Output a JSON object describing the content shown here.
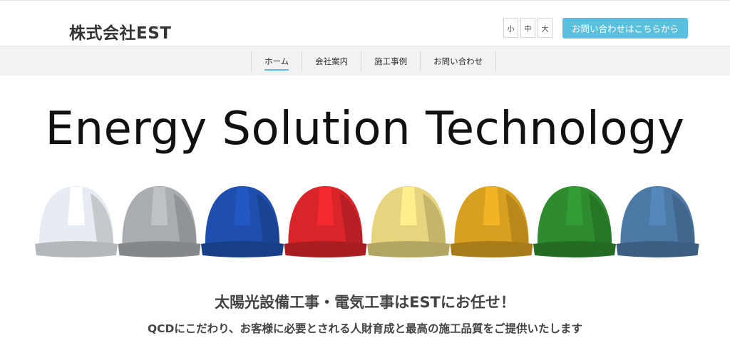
{
  "header": {
    "company_name": "株式会社EST",
    "font_size_buttons": [
      "小",
      "中",
      "大"
    ],
    "contact_button": "お問い合わせはこちらから"
  },
  "nav": {
    "items": [
      {
        "label": "ホーム",
        "active": true
      },
      {
        "label": "会社案内",
        "active": false
      },
      {
        "label": "施工事例",
        "active": false
      },
      {
        "label": "お問い合わせ",
        "active": false
      }
    ]
  },
  "hero": {
    "title": "Energy Solution Technology",
    "helmet_colors": [
      "#e6ecf1",
      "#a9adb2",
      "#1f4fae",
      "#d9252a",
      "#e6d57e",
      "#d8a020",
      "#2e8b2e",
      "#4c79a6"
    ]
  },
  "content": {
    "tagline": "太陽光設備工事・電気工事はESTにお任せ！",
    "subline": "QCDにこだわり、お客様に必要とされる人財育成と最高の施工品質をご提供いたします"
  },
  "colors": {
    "accent": "#5bc0de",
    "nav_bg": "#f2f2f2"
  }
}
